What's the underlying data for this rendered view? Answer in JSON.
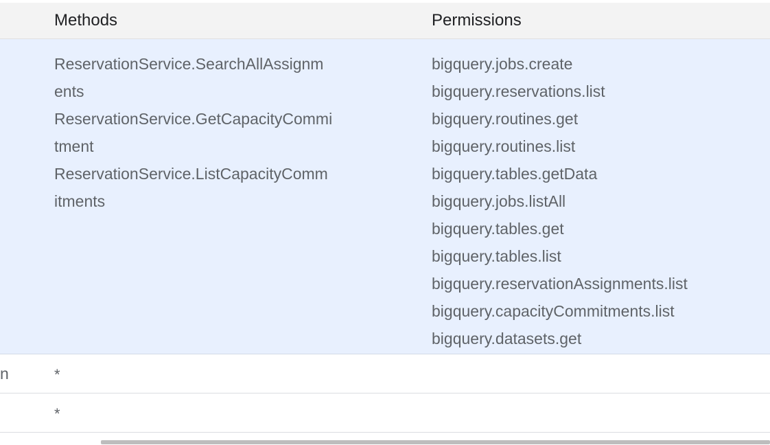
{
  "table": {
    "headers": {
      "methods": "Methods",
      "permissions": "Permissions"
    },
    "highlighted_row": {
      "methods": [
        "ReservationService.SearchAllAssignm",
        "ents",
        "ReservationService.GetCapacityCommi",
        "tment",
        "ReservationService.ListCapacityComm",
        "itments"
      ],
      "permissions": [
        "bigquery.jobs.create",
        "bigquery.reservations.list",
        "bigquery.routines.get",
        "bigquery.routines.list",
        "bigquery.tables.getData",
        "bigquery.jobs.listAll",
        "bigquery.tables.get",
        "bigquery.tables.list",
        "bigquery.reservationAssignments.list",
        "bigquery.capacityCommitments.list",
        "bigquery.datasets.get"
      ]
    },
    "rows": [
      {
        "left_text": "n",
        "methods": "*"
      },
      {
        "left_text": "",
        "methods": "*"
      }
    ]
  },
  "colors": {
    "header_bg": "#f3f3f3",
    "highlight_bg": "#e8f0fe",
    "text": "#5f6368"
  }
}
